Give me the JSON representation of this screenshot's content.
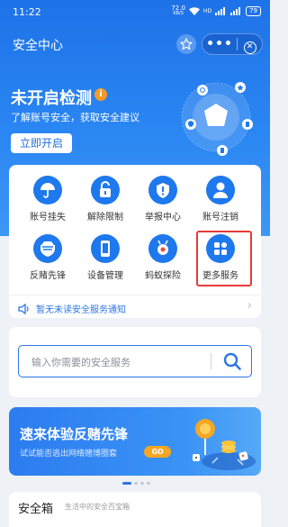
{
  "status_bar": {
    "time": "11:22",
    "net_speed": "72.0",
    "net_unit": "KB/S",
    "battery": "79"
  },
  "header": {
    "title": "安全中心"
  },
  "hero": {
    "headline": "未开启检测",
    "info_badge": "i",
    "subline": "了解账号安全，获取安全建议",
    "button_label": "立即开启"
  },
  "services": [
    {
      "label": "账号挂失",
      "icon": "umbrella-icon"
    },
    {
      "label": "解除限制",
      "icon": "unlock-icon"
    },
    {
      "label": "举报中心",
      "icon": "report-shield-icon"
    },
    {
      "label": "账号注销",
      "icon": "user-icon"
    },
    {
      "label": "反赌先锋",
      "icon": "anti-gambling-shield-icon"
    },
    {
      "label": "设备管理",
      "icon": "phone-device-icon"
    },
    {
      "label": "蚂蚁探险",
      "icon": "ant-icon"
    },
    {
      "label": "更多服务",
      "icon": "grid-apps-icon"
    }
  ],
  "notice": {
    "text": "暂无未读安全服务通知"
  },
  "search": {
    "placeholder": "输入你需要的安全服务"
  },
  "banner": {
    "title": "速来体验反赌先锋",
    "subtitle": "试试能否逃出网络赌博圈套",
    "go_label": "GO"
  },
  "bottom_section": {
    "title": "安全箱",
    "subtitle": "生活中的安全百宝箱"
  },
  "colors": {
    "primary": "#1e78ee",
    "highlight": "#e83a3a",
    "go_badge": "#f5a623"
  }
}
